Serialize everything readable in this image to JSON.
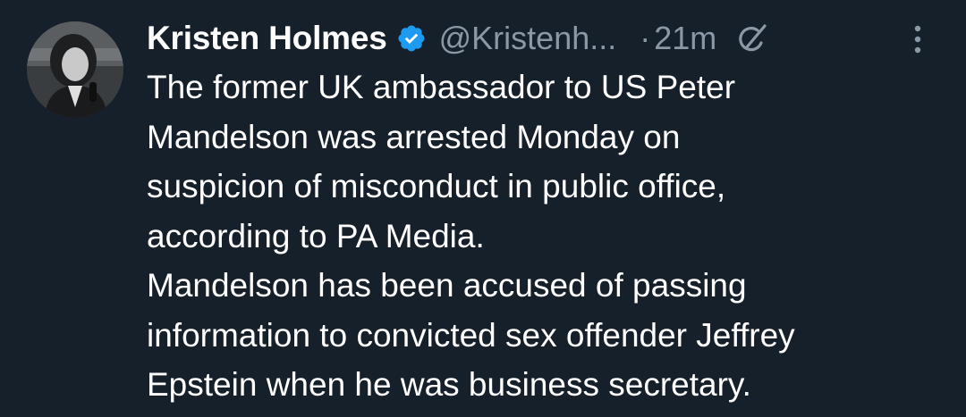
{
  "tweet": {
    "author": {
      "display_name": "Kristen Holmes",
      "handle": "@Kristenh...",
      "verified": true,
      "avatar_icon": "profile-photo"
    },
    "separator": "·",
    "time": "21m",
    "header_icons": [
      "verified-badge-icon",
      "grok-icon",
      "more-options-icon"
    ],
    "body_lines": [
      "The former UK ambassador to US Peter",
      "Mandelson was arrested Monday on",
      "suspicion of misconduct in public office,",
      "according to PA Media.",
      "Mandelson has been accused of passing",
      "information to convicted sex offender Jeffrey",
      "Epstein when he was business secretary."
    ]
  },
  "colors": {
    "background": "#15202b",
    "text_primary": "#ffffff",
    "text_secondary": "#8b98a5",
    "verified_blue": "#1d9bf0"
  }
}
